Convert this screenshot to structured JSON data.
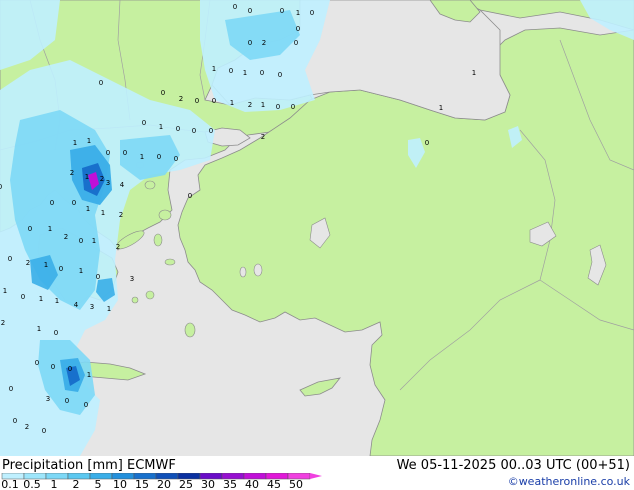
{
  "footer": {
    "title_label": "Precipitation [mm]",
    "model": "ECMWF",
    "date_label": "We 05-11-2025 00..03 UTC (00+51)",
    "credit": "©weatheronline.co.uk"
  },
  "legend": {
    "ticks": [
      "0.1",
      "0.5",
      "1",
      "2",
      "5",
      "10",
      "15",
      "20",
      "25",
      "30",
      "35",
      "40",
      "45",
      "50"
    ],
    "colors": [
      "#bff0ff",
      "#9ee6fb",
      "#7dd8f6",
      "#5cc8f0",
      "#3aaee8",
      "#2390dc",
      "#1870cc",
      "#1050b8",
      "#0a30a0",
      "#6a0cc8",
      "#9610d0",
      "#c010d8",
      "#e018d8",
      "#f040e0"
    ]
  },
  "colors": {
    "sea": "#e6e6e6",
    "land": "#c6f0a0",
    "border": "#a0a0a0",
    "coast": "#8c8c8c"
  },
  "map_values": [
    "0",
    "0",
    "0",
    "1",
    "0",
    "0",
    "0",
    "2",
    "0",
    "0",
    "1",
    "0",
    "0",
    "1",
    "0",
    "0",
    "2",
    "0",
    "0",
    "1",
    "2",
    "1",
    "0",
    "0",
    "0",
    "1",
    "0",
    "0",
    "0",
    "2",
    "1",
    "1",
    "0",
    "1",
    "1",
    "0",
    "0",
    "1",
    "0",
    "0",
    "2",
    "1",
    "2",
    "3",
    "4",
    "0",
    "0",
    "0",
    "1",
    "1",
    "2",
    "0",
    "1",
    "2",
    "0",
    "1",
    "2",
    "0",
    "2",
    "1",
    "0",
    "1",
    "0",
    "3",
    "1",
    "0",
    "1",
    "1",
    "4",
    "3",
    "1",
    "2",
    "1",
    "0",
    "0",
    "0",
    "0",
    "1",
    "0",
    "3",
    "0",
    "0",
    "0",
    "2",
    "0",
    "0",
    "0",
    "0",
    "0",
    "0",
    "0",
    "0"
  ]
}
